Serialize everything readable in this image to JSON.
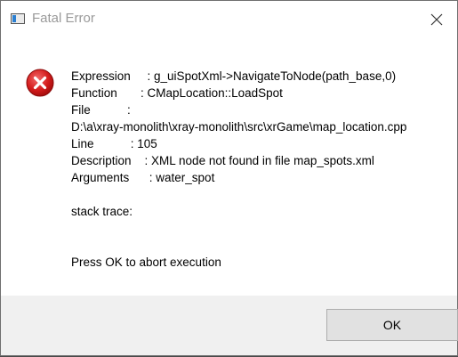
{
  "window": {
    "title": "Fatal Error",
    "icon": "app-window-icon",
    "close_icon": "close-icon"
  },
  "message": {
    "icon": "error-icon",
    "expression": "Expression     : g_uiSpotXml->NavigateToNode(path_base,0)",
    "function": "Function       : CMapLocation::LoadSpot",
    "file_label": "File           :",
    "file_path": "D:\\a\\xray-monolith\\xray-monolith\\src\\xrGame\\map_location.cpp",
    "line": "Line           : 105",
    "description": "Description    : XML node not found in file map_spots.xml",
    "arguments": "Arguments      : water_spot",
    "stack_trace": "stack trace:",
    "prompt": "Press OK to abort execution"
  },
  "buttons": {
    "ok_label": "OK"
  },
  "colors": {
    "error_red": "#e81123",
    "button_bg": "#e1e1e1",
    "footer_bg": "#f0f0f0",
    "title_text": "#9a9a9a"
  }
}
